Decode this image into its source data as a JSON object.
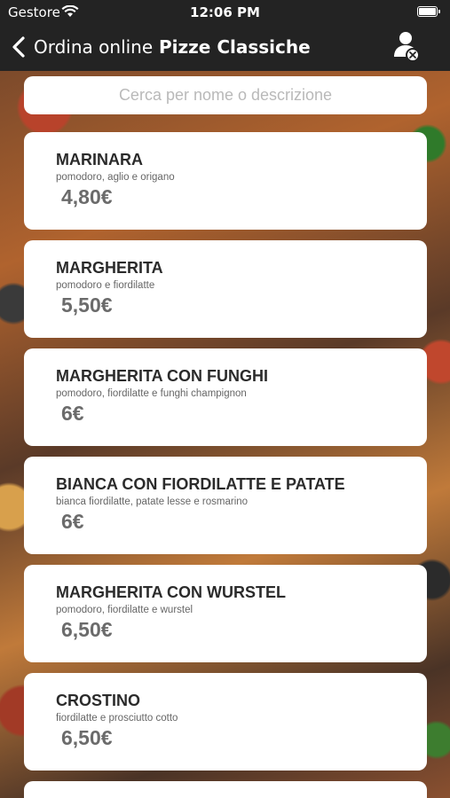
{
  "status_bar": {
    "carrier": "Gestore",
    "time": "12:06 PM"
  },
  "nav": {
    "back_label": "Ordina online",
    "title": "Pizze Classiche"
  },
  "search": {
    "placeholder": "Cerca per nome o descrizione",
    "value": ""
  },
  "menu_items": [
    {
      "name": "MARINARA",
      "description": "pomodoro, aglio e origano",
      "price": "4,80€"
    },
    {
      "name": "MARGHERITA",
      "description": "pomodoro e fiordilatte",
      "price": "5,50€"
    },
    {
      "name": "MARGHERITA CON FUNGHI",
      "description": "pomodoro, fiordilatte e funghi champignon",
      "price": "6€"
    },
    {
      "name": "BIANCA CON FIORDILATTE E PATATE",
      "description": "bianca fiordilatte, patate lesse e rosmarino",
      "price": "6€"
    },
    {
      "name": "MARGHERITA CON WURSTEL",
      "description": "pomodoro, fiordilatte e wurstel",
      "price": "6,50€"
    },
    {
      "name": "CROSTINO",
      "description": "fiordilatte e prosciutto cotto",
      "price": "6,50€"
    }
  ],
  "colors": {
    "bar_background": "#232323",
    "card_background": "#ffffff",
    "price_text": "#6b6b6b",
    "name_text": "#2b2b2b"
  },
  "icons": {
    "back": "chevron-left-icon",
    "profile": "user-remove-icon",
    "wifi": "wifi-icon",
    "battery": "battery-icon"
  }
}
